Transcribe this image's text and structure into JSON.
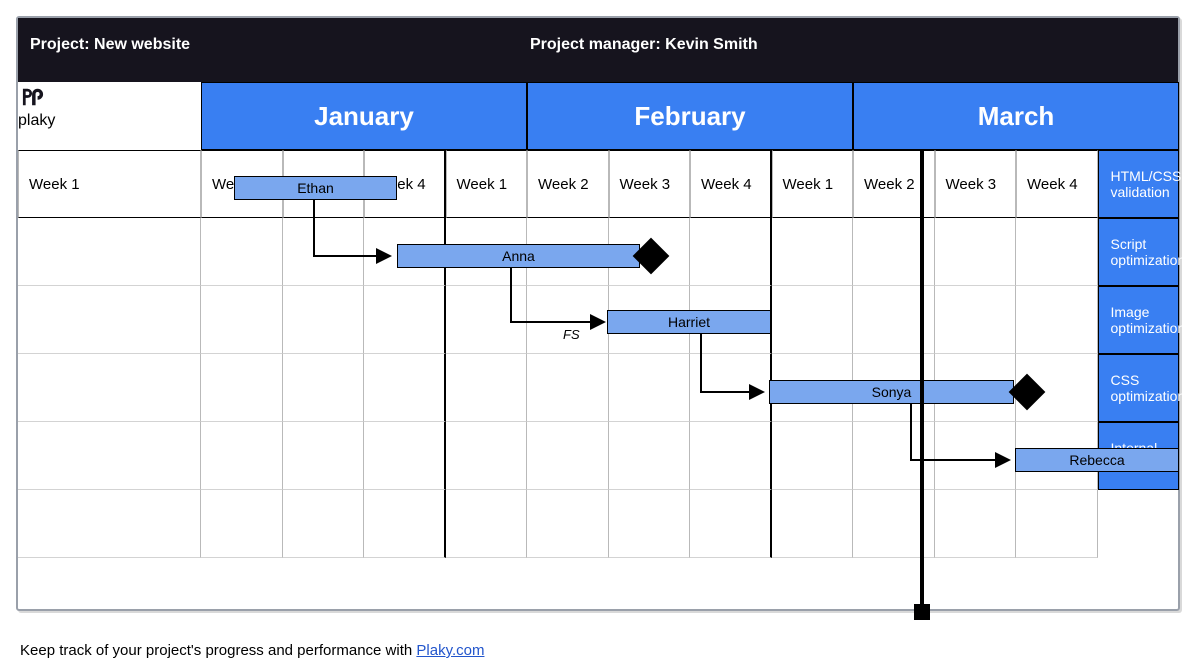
{
  "project_label": "Project: New website",
  "manager_label": "Project manager: Kevin Smith",
  "brand": "plaky",
  "months": [
    "January",
    "February",
    "March"
  ],
  "weeks": [
    "Week 1",
    "Week 2",
    "Week 3",
    "Week 4"
  ],
  "tasks": [
    {
      "label": "HTML/CSS validation",
      "assignee": "Ethan"
    },
    {
      "label": "Script optimization",
      "assignee": "Anna"
    },
    {
      "label": "Image optimization",
      "assignee": "Harriet"
    },
    {
      "label": "CSS optimization",
      "assignee": "Sonya"
    },
    {
      "label": "Internal links",
      "assignee": "Rebecca"
    }
  ],
  "fs_label": "FS",
  "caption_prefix": "Keep track of your project's progress and performance with ",
  "caption_link": "Plaky.com",
  "chart_data": {
    "type": "gantt",
    "title": "New website",
    "x_axis": {
      "months": [
        "January",
        "February",
        "March"
      ],
      "weeks_per_month": 4,
      "total_weeks": 12
    },
    "today_marker_week": 8.8,
    "tasks": [
      {
        "name": "HTML/CSS validation",
        "assignee": "Ethan",
        "start_week": 0.4,
        "end_week": 2.4,
        "dependency_to": "Script optimization",
        "dependency_type": "FS"
      },
      {
        "name": "Script optimization",
        "assignee": "Anna",
        "start_week": 2.4,
        "end_week": 5.4,
        "milestone_at_end": true,
        "dependency_to": "Image optimization",
        "dependency_type": "FS"
      },
      {
        "name": "Image optimization",
        "assignee": "Harriet",
        "start_week": 5.0,
        "end_week": 7.0,
        "dependency_to": "CSS optimization",
        "dependency_type": "FS"
      },
      {
        "name": "CSS optimization",
        "assignee": "Sonya",
        "start_week": 7.0,
        "end_week": 10.0,
        "milestone_at_end": true,
        "dependency_to": "Internal links",
        "dependency_type": "FS"
      },
      {
        "name": "Internal links",
        "assignee": "Rebecca",
        "start_week": 10.0,
        "end_week": 12.0
      }
    ]
  }
}
